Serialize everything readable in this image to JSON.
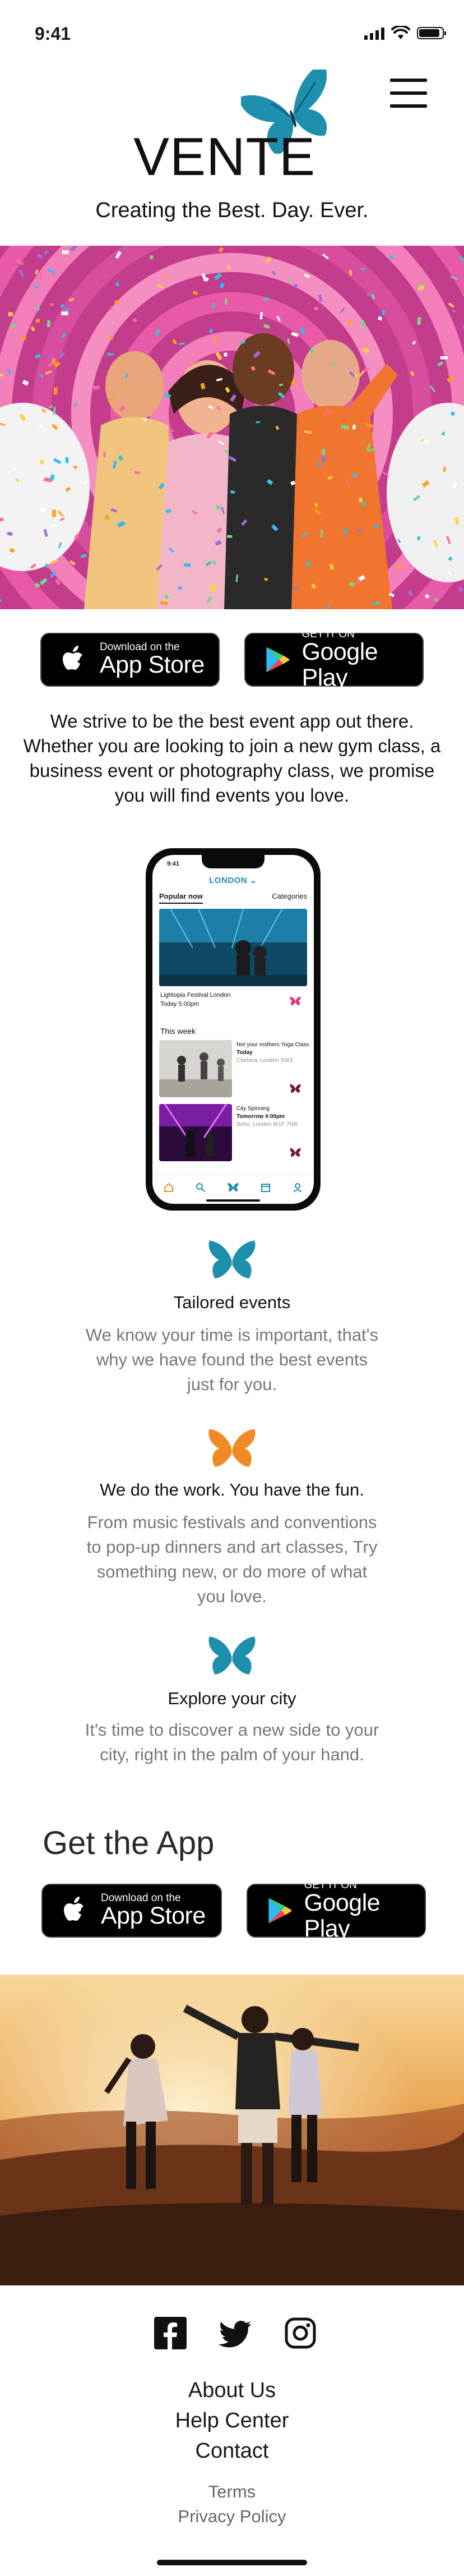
{
  "status_bar": {
    "time": "9:41"
  },
  "header": {
    "brand": "VENTE",
    "tagline": "Creating the Best. Day. Ever."
  },
  "store_badges": {
    "apple": {
      "small": "Download on the",
      "big": "App Store"
    },
    "google": {
      "small": "GET IT ON",
      "big": "Google Play"
    }
  },
  "intro": "We strive to be the best event app out there. Whether you are looking to join a new gym class, a business event or photography class, we promise you will find events you love.",
  "phone": {
    "time": "9:41",
    "city": "LONDON",
    "tabs": [
      "Popular now",
      "Categories"
    ],
    "featured": {
      "title": "Lightopia Festival London",
      "date": "Today 5:00pm"
    },
    "section": "This week",
    "events": [
      {
        "title": "Not your mothers Yoga Class",
        "when": "Today",
        "where": "Chelsea, London SW3"
      },
      {
        "title": "City Spinning",
        "when": "Tomorrow 4:00pm",
        "where": "Soho, London W1F 7NR"
      }
    ]
  },
  "features": [
    {
      "title": "Tailored events",
      "body": "We know your time is important, that's why we have found the best events just for you.",
      "icon_color": "#1f8fae"
    },
    {
      "title": "We do the work. You have the fun.",
      "body": "From music festivals and conventions to pop-up dinners and art classes, Try something new, or do more of what you love.",
      "icon_color": "#f08a24"
    },
    {
      "title": "Explore your city",
      "body": "It's time to discover a new side to your city, right in the palm of your hand.",
      "icon_color": "#1f8fae"
    }
  ],
  "get_app_heading": "Get the App",
  "footer": {
    "social": [
      "facebook-icon",
      "twitter-icon",
      "instagram-icon"
    ],
    "links": [
      "About Us",
      "Help Center",
      "Contact"
    ],
    "legal": [
      "Terms",
      "Privacy Policy"
    ]
  },
  "colors": {
    "brand_blue": "#1f8fae",
    "brand_orange": "#f08a24",
    "brand_maroon": "#7a1530",
    "brand_pink": "#e0337a"
  }
}
